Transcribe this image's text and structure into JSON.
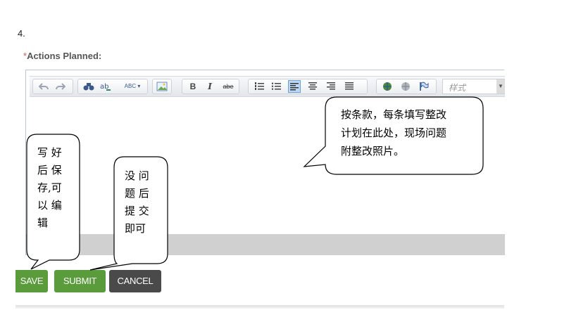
{
  "step_number": "4.",
  "field": {
    "required_mark": "*",
    "label": "Actions Planned:"
  },
  "editor": {
    "toolbar": {
      "undo_icon": "undo-icon",
      "redo_icon": "redo-icon",
      "find_icon": "binoculars-icon",
      "replace_icon": "find-replace-icon",
      "spellcheck_label": "ABC",
      "image_icon": "image-icon",
      "bold_label": "B",
      "italic_label": "I",
      "strike_label": "abe",
      "ordered_list_icon": "numbered-list-icon",
      "bullet_list_icon": "bulleted-list-icon",
      "align_left_icon": "align-left-icon",
      "align_center_icon": "align-center-icon",
      "align_right_icon": "align-right-icon",
      "justify_icon": "align-justify-icon",
      "link_icon": "link-icon",
      "unlink_icon": "unlink-icon",
      "anchor_icon": "flag-icon",
      "style_placeholder": "样式"
    },
    "content": ""
  },
  "buttons": {
    "save": "SAVE",
    "submit": "SUBMIT",
    "cancel": "CANCEL"
  },
  "callouts": {
    "editor_note": "按条款，每条填写整改\n计划在此处，现场问题\n附整改照片。",
    "save_note": "写 好\n后 保\n存,可\n以 编\n辑",
    "submit_note": "没 问\n题 后\n提 交\n即可"
  },
  "colors": {
    "required": "#d9534f",
    "save_submit_bg": "#5a9c3c",
    "cancel_bg": "#4a4a4a"
  }
}
